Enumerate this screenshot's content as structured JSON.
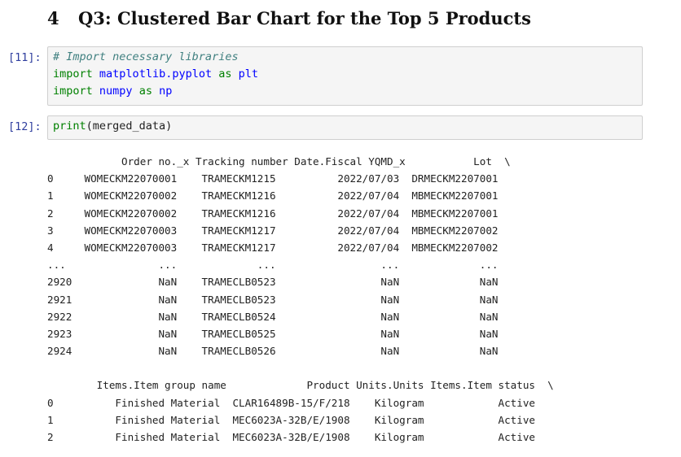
{
  "heading": {
    "number": "4",
    "title": "Q3: Clustered Bar Chart for the Top 5 Products"
  },
  "cells": [
    {
      "prompt": "[11]:",
      "lines": [
        [
          {
            "t": "# Import necessary libraries",
            "c": "cm"
          }
        ],
        [
          {
            "t": "import",
            "c": "kw"
          },
          {
            "t": " ",
            "c": "tx"
          },
          {
            "t": "matplotlib.pyplot",
            "c": "mod"
          },
          {
            "t": " ",
            "c": "tx"
          },
          {
            "t": "as",
            "c": "kw"
          },
          {
            "t": " ",
            "c": "tx"
          },
          {
            "t": "plt",
            "c": "mod"
          }
        ],
        [
          {
            "t": "import",
            "c": "kw"
          },
          {
            "t": " ",
            "c": "tx"
          },
          {
            "t": "numpy",
            "c": "mod"
          },
          {
            "t": " ",
            "c": "tx"
          },
          {
            "t": "as",
            "c": "kw"
          },
          {
            "t": " ",
            "c": "tx"
          },
          {
            "t": "np",
            "c": "mod"
          }
        ]
      ]
    },
    {
      "prompt": "[12]:",
      "lines": [
        [
          {
            "t": "print",
            "c": "fn"
          },
          {
            "t": "(merged_data)",
            "c": "tx"
          }
        ]
      ]
    }
  ],
  "output_lines": [
    "            Order no._x Tracking number Date.Fiscal YQMD_x           Lot  \\",
    "0     WOMECKM22070001    TRAMECKM1215          2022/07/03  DRMECKM2207001",
    "1     WOMECKM22070002    TRAMECKM1216          2022/07/04  MBMECKM2207001",
    "2     WOMECKM22070002    TRAMECKM1216          2022/07/04  MBMECKM2207001",
    "3     WOMECKM22070003    TRAMECKM1217          2022/07/04  MBMECKM2207002",
    "4     WOMECKM22070003    TRAMECKM1217          2022/07/04  MBMECKM2207002",
    "...               ...             ...                 ...             ...",
    "2920              NaN    TRAMECLB0523                 NaN             NaN",
    "2921              NaN    TRAMECLB0523                 NaN             NaN",
    "2922              NaN    TRAMECLB0524                 NaN             NaN",
    "2923              NaN    TRAMECLB0525                 NaN             NaN",
    "2924              NaN    TRAMECLB0526                 NaN             NaN",
    "",
    "        Items.Item group name             Product Units.Units Items.Item status  \\",
    "0          Finished Material  CLAR16489B-15/F/218    Kilogram            Active",
    "1          Finished Material  MEC6023A-32B/E/1908    Kilogram            Active",
    "2          Finished Material  MEC6023A-32B/E/1908    Kilogram            Active"
  ]
}
